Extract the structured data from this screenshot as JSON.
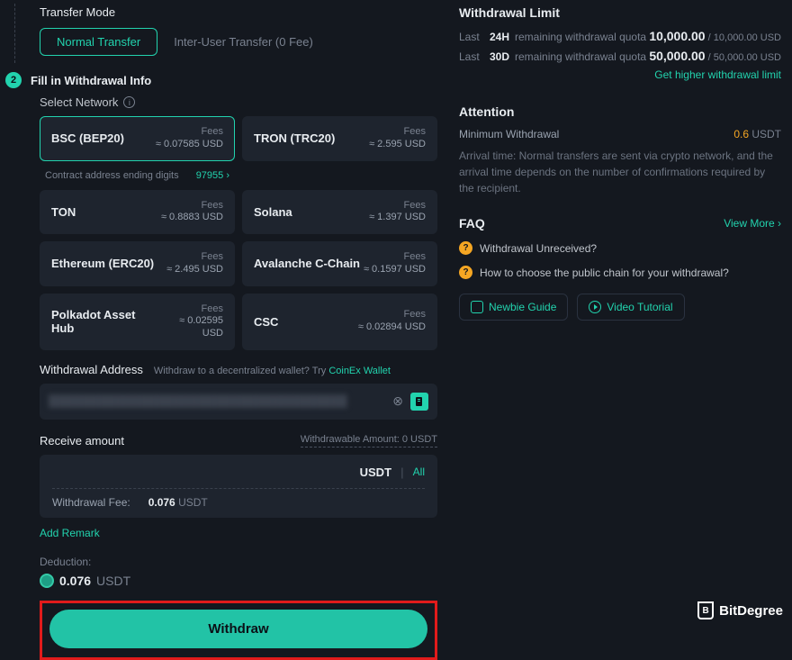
{
  "transfer": {
    "mode_label": "Transfer Mode",
    "normal": "Normal Transfer",
    "inter": "Inter-User Transfer (0 Fee)"
  },
  "step": {
    "num": "2",
    "title": "Fill in Withdrawal Info",
    "select_network": "Select Network"
  },
  "networks": [
    {
      "name": "BSC (BEP20)",
      "fee": "≈ 0.07585 USD",
      "selected": true
    },
    {
      "name": "TRON (TRC20)",
      "fee": "≈ 2.595 USD"
    },
    {
      "name": "TON",
      "fee": "≈ 0.8883 USD"
    },
    {
      "name": "Solana",
      "fee": "≈ 1.397 USD"
    },
    {
      "name": "Ethereum (ERC20)",
      "fee": "≈ 2.495 USD"
    },
    {
      "name": "Avalanche C-Chain",
      "fee": "≈ 0.1597 USD"
    },
    {
      "name": "Polkadot Asset Hub",
      "fee": "≈ 0.02595 USD"
    },
    {
      "name": "CSC",
      "fee": "≈ 0.02894 USD"
    }
  ],
  "fees_label": "Fees",
  "contract": {
    "label": "Contract address ending digits",
    "value": "97955 ›"
  },
  "address": {
    "label": "Withdrawal Address",
    "hint_prefix": "Withdraw to a decentralized wallet? Try ",
    "hint_link": "CoinEx Wallet",
    "value": "████████████████████████████████████"
  },
  "receive": {
    "label": "Receive amount",
    "withdrawable_label": "Withdrawable Amount: ",
    "withdrawable_value": "0",
    "withdrawable_unit": " USDT",
    "currency": "USDT",
    "all": "All",
    "fee_label": "Withdrawal Fee:",
    "fee_value": "0.076",
    "fee_unit": "USDT"
  },
  "add_remark": "Add Remark",
  "deduction": {
    "label": "Deduction:",
    "value": "0.076",
    "unit": "USDT"
  },
  "withdraw_btn": "Withdraw",
  "limit": {
    "title": "Withdrawal Limit",
    "row1": {
      "l1": "Last",
      "l2": "24H",
      "l3": "remaining withdrawal quota",
      "big": "10,000.00",
      "sep": " / ",
      "sub": "10,000.00 USD"
    },
    "row2": {
      "l1": "Last",
      "l2": "30D",
      "l3": "remaining withdrawal quota",
      "big": "50,000.00",
      "sep": " / ",
      "sub": "50,000.00 USD"
    },
    "link": "Get higher withdrawal limit"
  },
  "attention": {
    "title": "Attention",
    "min_label": "Minimum Withdrawal",
    "min_value": "0.6",
    "min_unit": " USDT",
    "desc": "Arrival time: Normal transfers are sent via crypto network, and the arrival time depends on the number of confirmations required by the recipient."
  },
  "faq": {
    "title": "FAQ",
    "more": "View More ›",
    "items": [
      "Withdrawal Unreceived?",
      "How to choose the public chain for your withdrawal?"
    ]
  },
  "guides": {
    "newbie": "Newbie Guide",
    "video": "Video Tutorial"
  },
  "watermark": "BitDegree"
}
